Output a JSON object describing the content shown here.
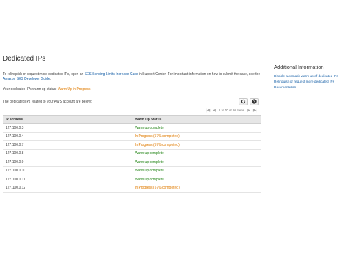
{
  "main": {
    "title": "Dedicated IPs",
    "intro_prefix": "To relinquish or request more dedicated IPs, open an",
    "intro_link": "SES Sending Limits Increase Case",
    "intro_middle": "in Support Center. For important information on how to submit the case, see the",
    "intro_guide_link": "Amazon SES Developer Guide",
    "intro_suffix": ".",
    "warmup_label": "Your dedicated IPs warm up status:",
    "warmup_value": "Warm Up in Progress",
    "list_description": "The dedicated IPs related to your AWS account are below:",
    "refresh_icon": "refresh-icon",
    "help_icon": "help-icon",
    "pager": {
      "first": "|◀",
      "prev": "◀",
      "text": "1 to 10 of 10 Items",
      "next": "▶",
      "last": "▶|"
    }
  },
  "table": {
    "headers": {
      "ip": "IP address",
      "status": "Warm Up Status"
    },
    "rows": [
      {
        "ip": "127.100.0.3",
        "status": "Warm up complete",
        "state": "complete"
      },
      {
        "ip": "127.100.0.4",
        "status": "In Progress (57% completed)",
        "state": "progress"
      },
      {
        "ip": "127.100.0.7",
        "status": "In Progress (57% completed)",
        "state": "progress"
      },
      {
        "ip": "127.100.0.8",
        "status": "Warm up complete",
        "state": "complete"
      },
      {
        "ip": "127.100.0.9",
        "status": "Warm up complete",
        "state": "complete"
      },
      {
        "ip": "127.100.0.10",
        "status": "Warm up complete",
        "state": "complete"
      },
      {
        "ip": "127.100.0.11",
        "status": "Warm up complete",
        "state": "complete"
      },
      {
        "ip": "127.100.0.12",
        "status": "In Progress (57% completed)",
        "state": "progress"
      }
    ]
  },
  "sidebar": {
    "title": "Additional Information",
    "links": [
      "Disable automatic warm up of dedicated IPs",
      "Relinquish or request more dedicated IPs",
      "Documentation"
    ]
  },
  "colors": {
    "link": "#1a62a8",
    "warning": "#e07b00",
    "success": "#2e8b22"
  }
}
